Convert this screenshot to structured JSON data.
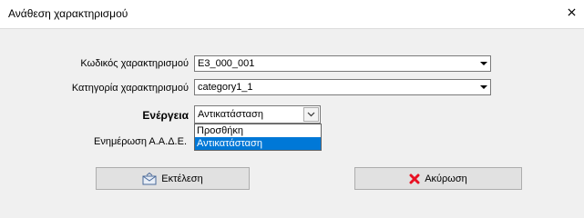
{
  "window": {
    "title": "Ανάθεση χαρακτηρισμού"
  },
  "form": {
    "code_label": "Κωδικός χαρακτηρισμού",
    "code_value": "E3_000_001",
    "category_label": "Κατηγορία χαρακτηρισμού",
    "category_value": "category1_1",
    "action_label": "Ενέργεια",
    "action_value": "Αντικατάσταση",
    "action_options": [
      "Προσθήκη",
      "Αντικατάσταση"
    ],
    "action_selected_index": 1,
    "aade_label": "Ενημέρωση Α.Α.Δ.Ε."
  },
  "buttons": {
    "execute_label": "Εκτέλεση",
    "cancel_label": "Ακύρωση"
  },
  "icons": {
    "close": "close-icon",
    "execute": "envelope-icon",
    "cancel": "red-x-icon"
  },
  "colors": {
    "selection": "#0078d7",
    "cancel_icon": "#e81123"
  }
}
